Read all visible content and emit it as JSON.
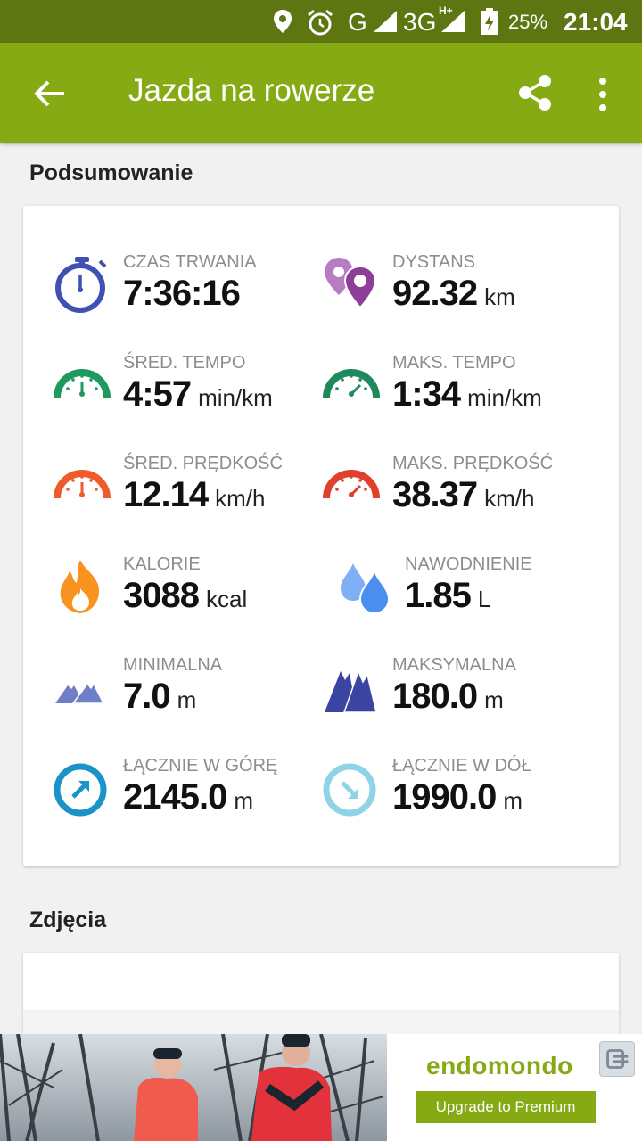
{
  "status_bar": {
    "network_1": "G",
    "network_2": "3G",
    "network_2_sup": "H+",
    "battery": "25%",
    "time": "21:04",
    "icons": [
      "location-icon",
      "alarm-icon",
      "signal-icon",
      "signal-icon",
      "battery-charging-icon"
    ]
  },
  "app_bar": {
    "title": "Jazda na rowerze",
    "color": "#86aa14",
    "back_icon": "arrow-back-icon",
    "share_icon": "share-icon",
    "more_icon": "more-vert-icon"
  },
  "summary": {
    "title": "Podsumowanie",
    "stats": [
      {
        "label": "CZAS TRWANIA",
        "value": "7:36:16",
        "unit": "",
        "icon": "stopwatch-icon",
        "color": "#3f51b5"
      },
      {
        "label": "DYSTANS",
        "value": "92.32",
        "unit": "km",
        "icon": "map-pins-icon",
        "color": "#8e3d98"
      },
      {
        "label": "ŚRED. TEMPO",
        "value": "4:57",
        "unit": "min/km",
        "icon": "gauge-icon",
        "color": "#1e9960"
      },
      {
        "label": "MAKS. TEMPO",
        "value": "1:34",
        "unit": "min/km",
        "icon": "gauge-icon",
        "color": "#1e8a5c"
      },
      {
        "label": "ŚRED. PRĘDKOŚĆ",
        "value": "12.14",
        "unit": "km/h",
        "icon": "gauge-icon",
        "color": "#ee5b2d"
      },
      {
        "label": "MAKS. PRĘDKOŚĆ",
        "value": "38.37",
        "unit": "km/h",
        "icon": "gauge-icon",
        "color": "#e0402b"
      },
      {
        "label": "KALORIE",
        "value": "3088",
        "unit": "kcal",
        "icon": "flame-icon",
        "color": "#f7931e"
      },
      {
        "label": "NAWODNIENIE",
        "value": "1.85",
        "unit": "L",
        "icon": "water-drops-icon",
        "color": "#4a8ff0"
      },
      {
        "label": "MINIMALNA",
        "value": "7.0",
        "unit": "m",
        "icon": "mountains-low-icon",
        "color": "#6e7fc7"
      },
      {
        "label": "MAKSYMALNA",
        "value": "180.0",
        "unit": "m",
        "icon": "mountains-high-icon",
        "color": "#3b44a0"
      },
      {
        "label": "ŁĄCZNIE W GÓRĘ",
        "value": "2145.0",
        "unit": "m",
        "icon": "arrow-up-right-circle-icon",
        "color": "#1a93c9"
      },
      {
        "label": "ŁĄCZNIE W DÓŁ",
        "value": "1990.0",
        "unit": "m",
        "icon": "arrow-down-right-circle-icon",
        "color": "#8fd3e6"
      }
    ]
  },
  "photos": {
    "title": "Zdjęcia"
  },
  "ad": {
    "brand": "endomondo",
    "cta": "Upgrade to Premium"
  }
}
